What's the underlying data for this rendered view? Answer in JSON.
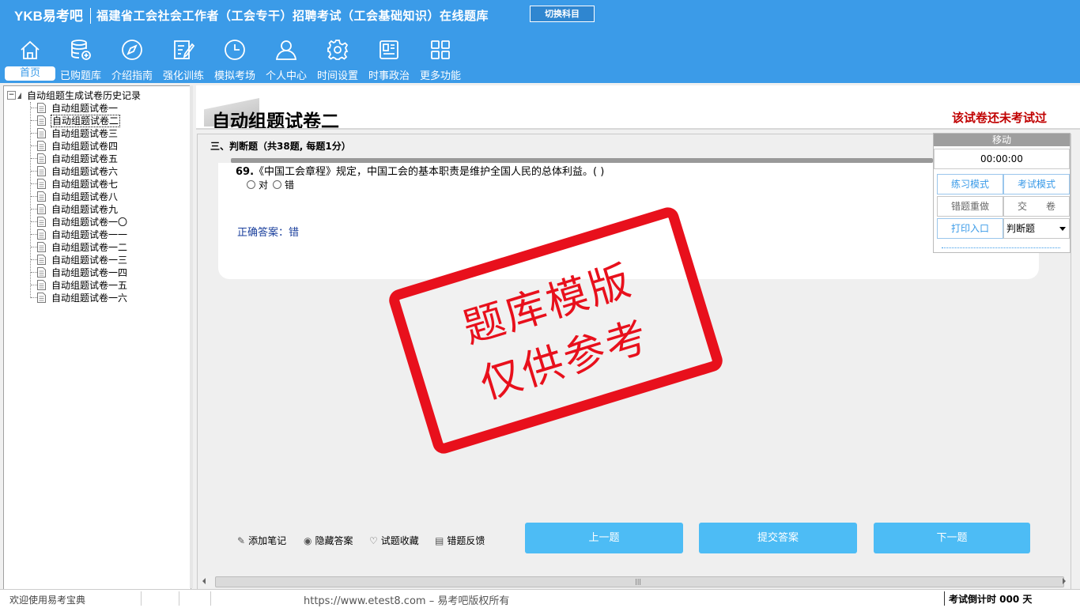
{
  "header": {
    "logo": "YKB易考吧",
    "title": "福建省工会社会工作者（工会专干）招聘考试（工会基础知识）在线题库",
    "switch_label": "切换科目"
  },
  "nav": [
    {
      "label": "首页",
      "icon": "home-icon"
    },
    {
      "label": "已购题库",
      "icon": "database-icon"
    },
    {
      "label": "介绍指南",
      "icon": "compass-icon"
    },
    {
      "label": "强化训练",
      "icon": "edit-icon"
    },
    {
      "label": "模拟考场",
      "icon": "clock-icon"
    },
    {
      "label": "个人中心",
      "icon": "user-icon"
    },
    {
      "label": "时间设置",
      "icon": "gear-icon"
    },
    {
      "label": "时事政治",
      "icon": "news-icon"
    },
    {
      "label": "更多功能",
      "icon": "grid-icon"
    }
  ],
  "tree": {
    "root": "自动组题生成试卷历史记录",
    "items": [
      "自动组题试卷一",
      "自动组题试卷二",
      "自动组题试卷三",
      "自动组题试卷四",
      "自动组题试卷五",
      "自动组题试卷六",
      "自动组题试卷七",
      "自动组题试卷八",
      "自动组题试卷九",
      "自动组题试卷一〇",
      "自动组题试卷一一",
      "自动组题试卷一二",
      "自动组题试卷一三",
      "自动组题试卷一四",
      "自动组题试卷一五",
      "自动组题试卷一六"
    ],
    "selected_index": 1
  },
  "exam": {
    "title": "自动组题试卷二",
    "status": "该试卷还未考试过",
    "section": "三、判断题（共38题, 每题1分）"
  },
  "question": {
    "number": "69.",
    "text": "《中国工会章程》规定，中国工会的基本职责是维护全国人民的总体利益。( )",
    "options": [
      "对",
      "错"
    ],
    "answer": "正确答案：错"
  },
  "stamp": {
    "line1": "题库模版",
    "line2": "仅供参考"
  },
  "side": {
    "move": "移动",
    "timer": "00:00:00",
    "practice": "练习模式",
    "exam_mode": "考试模式",
    "redo": "错题重做",
    "submit_paper": "交　　卷",
    "print": "打印入口",
    "type_select": "判断题"
  },
  "tools": [
    {
      "label": "添加笔记",
      "icon": "pencil-icon"
    },
    {
      "label": "隐藏答案",
      "icon": "eye-icon"
    },
    {
      "label": "试题收藏",
      "icon": "heart-icon"
    },
    {
      "label": "错题反馈",
      "icon": "feedback-icon"
    }
  ],
  "buttons": {
    "prev": "上一题",
    "submit": "提交答案",
    "next": "下一题"
  },
  "status": {
    "welcome": "欢迎使用易考宝典",
    "copyright": "https://www.etest8.com – 易考吧版权所有",
    "countdown": "考试倒计时 000 天"
  }
}
